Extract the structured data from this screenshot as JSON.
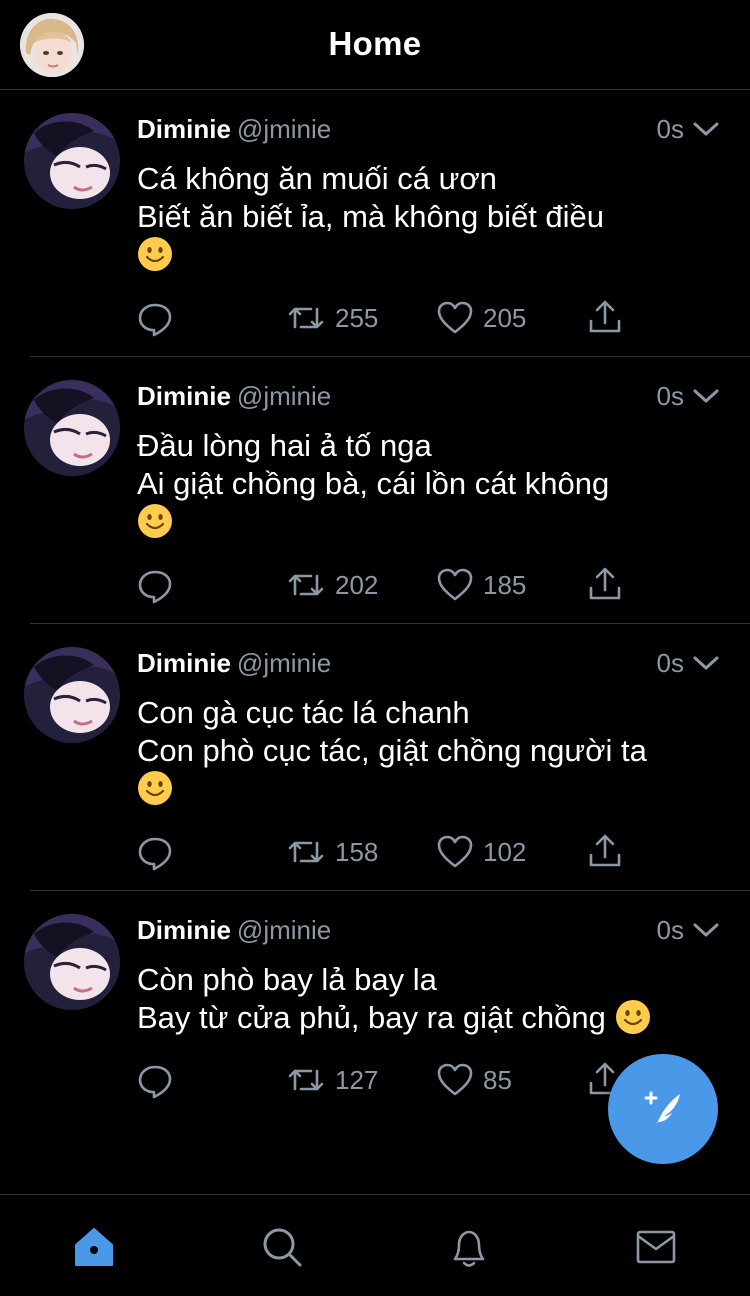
{
  "header": {
    "title": "Home"
  },
  "colors": {
    "accent": "#4a99e9",
    "muted": "#8b98a5",
    "background": "#000000"
  },
  "tweets": [
    {
      "name": "Diminie",
      "handle": "@jminie",
      "time": "0s",
      "lines": [
        "Cá không ăn muối cá ươn",
        "Biết ăn biết ỉa, mà không biết điều",
        "🙂"
      ],
      "retweets": "255",
      "likes": "205"
    },
    {
      "name": "Diminie",
      "handle": "@jminie",
      "time": "0s",
      "lines": [
        "Đầu lòng hai ả tố nga",
        "Ai giật chồng bà, cái lồn cát không",
        "🙂"
      ],
      "retweets": "202",
      "likes": "185"
    },
    {
      "name": "Diminie",
      "handle": "@jminie",
      "time": "0s",
      "lines": [
        "Con gà cục tác lá chanh",
        "Con phò cục tác, giật chồng người ta",
        "🙂"
      ],
      "retweets": "158",
      "likes": "102"
    },
    {
      "name": "Diminie",
      "handle": "@jminie",
      "time": "0s",
      "lines": [
        "Còn phò bay lả bay la",
        "Bay từ cửa phủ, bay ra giật chồng 🙂"
      ],
      "retweets": "127",
      "likes": "85"
    }
  ],
  "icons": {
    "header_avatar": "profile-avatar",
    "reply": "reply-icon",
    "retweet": "retweet-icon",
    "like": "heart-icon",
    "share": "share-icon",
    "compose": "compose-tweet-icon",
    "tabs": [
      "home-icon",
      "search-icon",
      "notifications-icon",
      "messages-icon"
    ]
  }
}
